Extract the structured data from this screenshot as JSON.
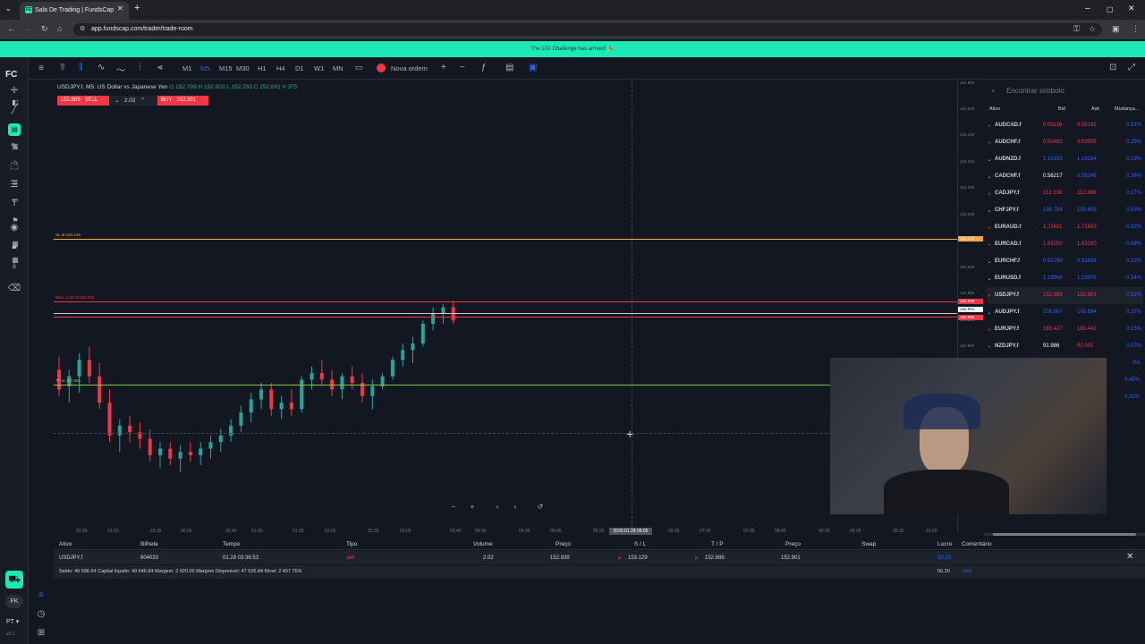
{
  "browser": {
    "tab_title": "Sala De Trading | FundsCap",
    "tab_favicon": "FC",
    "url": "app.fundscap.com/trader/trade-room",
    "new_tab": "+"
  },
  "banner": {
    "text": "The 10X Challenge has arrived! 🎉"
  },
  "app": {
    "logo": "FC",
    "user_initials": "FK",
    "language": "PT",
    "version": "v2.1"
  },
  "toolbar": {
    "timeframes": [
      "M1",
      "M5",
      "M15",
      "M30",
      "H1",
      "H4",
      "D1",
      "W1",
      "MN"
    ],
    "active_timeframe": "M5",
    "new_order": "Nova ordem"
  },
  "chart_header": {
    "symbol_title": "USDJPY.f, M5: US Dollar vs Japanese Yen",
    "ohlc": "O 152.799 H 152.903 L 152.783 C 152.891 V 375",
    "sell_price": "152.889",
    "sell_label": "SELL",
    "lot": "2.02",
    "buy_label": "BUY",
    "buy_price": "152.901"
  },
  "chart_lines": {
    "sl_label": "SL at 153.129",
    "sell_label": "SELL 2.02 at 152.939",
    "tp_label": "TP at 152.686"
  },
  "chart_data": {
    "type": "candlestick",
    "symbol": "USDJPY.f",
    "timeframe": "M5",
    "x_ticks": [
      "22:35",
      "23:00",
      "23:35",
      "00:05",
      "00:40",
      "01:00",
      "01:35",
      "02:00",
      "02:35",
      "03:00",
      "03:40",
      "04:00",
      "04:35",
      "05:00",
      "05:35",
      "2026.01.28 06:05",
      "06:35",
      "07:00",
      "07:35",
      "08:00",
      "08:35",
      "09:00",
      "09:35",
      "10:00"
    ],
    "y_ticks": [
      "153.600",
      "153.520",
      "153.440",
      "153.360",
      "153.280",
      "153.200",
      "153.120",
      "153.040",
      "152.960",
      "152.880",
      "152.800"
    ],
    "price_tags": {
      "sl": "153.129",
      "sell_entry": "152.939",
      "ask": "152.901",
      "bid": "152.889"
    },
    "ylim": [
      152.66,
      153.62
    ],
    "candles": [
      {
        "o": 152.72,
        "h": 152.76,
        "l": 152.64,
        "c": 152.66
      },
      {
        "o": 152.67,
        "h": 152.72,
        "l": 152.62,
        "c": 152.7
      },
      {
        "o": 152.7,
        "h": 152.77,
        "l": 152.65,
        "c": 152.75
      },
      {
        "o": 152.75,
        "h": 152.79,
        "l": 152.68,
        "c": 152.7
      },
      {
        "o": 152.7,
        "h": 152.74,
        "l": 152.6,
        "c": 152.62
      },
      {
        "o": 152.62,
        "h": 152.66,
        "l": 152.5,
        "c": 152.52
      },
      {
        "o": 152.52,
        "h": 152.57,
        "l": 152.47,
        "c": 152.55
      },
      {
        "o": 152.55,
        "h": 152.58,
        "l": 152.5,
        "c": 152.53
      },
      {
        "o": 152.53,
        "h": 152.56,
        "l": 152.48,
        "c": 152.51
      },
      {
        "o": 152.51,
        "h": 152.54,
        "l": 152.44,
        "c": 152.46
      },
      {
        "o": 152.46,
        "h": 152.5,
        "l": 152.42,
        "c": 152.48
      },
      {
        "o": 152.48,
        "h": 152.5,
        "l": 152.43,
        "c": 152.45
      },
      {
        "o": 152.45,
        "h": 152.49,
        "l": 152.41,
        "c": 152.47
      },
      {
        "o": 152.47,
        "h": 152.5,
        "l": 152.44,
        "c": 152.46
      },
      {
        "o": 152.46,
        "h": 152.5,
        "l": 152.43,
        "c": 152.48
      },
      {
        "o": 152.48,
        "h": 152.52,
        "l": 152.45,
        "c": 152.5
      },
      {
        "o": 152.5,
        "h": 152.54,
        "l": 152.47,
        "c": 152.52
      },
      {
        "o": 152.52,
        "h": 152.57,
        "l": 152.5,
        "c": 152.55
      },
      {
        "o": 152.55,
        "h": 152.61,
        "l": 152.53,
        "c": 152.59
      },
      {
        "o": 152.59,
        "h": 152.65,
        "l": 152.56,
        "c": 152.63
      },
      {
        "o": 152.63,
        "h": 152.68,
        "l": 152.6,
        "c": 152.66
      },
      {
        "o": 152.66,
        "h": 152.68,
        "l": 152.58,
        "c": 152.6
      },
      {
        "o": 152.6,
        "h": 152.64,
        "l": 152.57,
        "c": 152.62
      },
      {
        "o": 152.62,
        "h": 152.66,
        "l": 152.58,
        "c": 152.6
      },
      {
        "o": 152.6,
        "h": 152.7,
        "l": 152.59,
        "c": 152.69
      },
      {
        "o": 152.69,
        "h": 152.73,
        "l": 152.66,
        "c": 152.71
      },
      {
        "o": 152.71,
        "h": 152.75,
        "l": 152.67,
        "c": 152.69
      },
      {
        "o": 152.69,
        "h": 152.72,
        "l": 152.64,
        "c": 152.66
      },
      {
        "o": 152.66,
        "h": 152.71,
        "l": 152.63,
        "c": 152.7
      },
      {
        "o": 152.7,
        "h": 152.73,
        "l": 152.66,
        "c": 152.68
      },
      {
        "o": 152.68,
        "h": 152.71,
        "l": 152.62,
        "c": 152.64
      },
      {
        "o": 152.64,
        "h": 152.69,
        "l": 152.6,
        "c": 152.67
      },
      {
        "o": 152.67,
        "h": 152.71,
        "l": 152.66,
        "c": 152.7
      },
      {
        "o": 152.7,
        "h": 152.76,
        "l": 152.69,
        "c": 152.75
      },
      {
        "o": 152.75,
        "h": 152.8,
        "l": 152.73,
        "c": 152.78
      },
      {
        "o": 152.78,
        "h": 152.82,
        "l": 152.74,
        "c": 152.8
      },
      {
        "o": 152.8,
        "h": 152.87,
        "l": 152.79,
        "c": 152.86
      },
      {
        "o": 152.86,
        "h": 152.91,
        "l": 152.84,
        "c": 152.89
      },
      {
        "o": 152.89,
        "h": 152.92,
        "l": 152.86,
        "c": 152.91
      },
      {
        "o": 152.91,
        "h": 152.93,
        "l": 152.86,
        "c": 152.87
      }
    ]
  },
  "watchlist": {
    "search_placeholder": "Encontrar símbolo",
    "headers": [
      "Ativo",
      "Bid",
      "Ask",
      "Mudança..."
    ],
    "rows": [
      {
        "symbol": "AUDCAD.f",
        "bid": "0.95116",
        "ask": "0.95142",
        "change": "0.01%",
        "dir": "down"
      },
      {
        "symbol": "AUDCHF.f",
        "bid": "0.53482",
        "ask": "0.53508",
        "change": "0.29%",
        "dir": "down"
      },
      {
        "symbol": "AUDNZD.f",
        "bid": "1.16163",
        "ask": "1.16194",
        "change": "0.19%",
        "dir": "up"
      },
      {
        "symbol": "CADCHF.f",
        "bid": "0.56217",
        "ask": "0.56249",
        "change": "0.36%",
        "dir": "up"
      },
      {
        "symbol": "CADJPY.f",
        "bid": "112.338",
        "ask": "112.366",
        "change": "0.27%",
        "dir": "down"
      },
      {
        "symbol": "CHFJPY.f",
        "bid": "199.784",
        "ask": "199.809",
        "change": "0.03%",
        "dir": "up"
      },
      {
        "symbol": "EURAUD.f",
        "bid": "1.71611",
        "ask": "1.71635",
        "change": "-0.02%",
        "dir": "down"
      },
      {
        "symbol": "EURCAD.f",
        "bid": "1.63250",
        "ask": "1.63280",
        "change": "-0.09%",
        "dir": "down"
      },
      {
        "symbol": "EURCHF.f",
        "bid": "0.91799",
        "ask": "0.91818",
        "change": "0.22%",
        "dir": "up"
      },
      {
        "symbol": "EURUSD.f",
        "bid": "1.19968",
        "ask": "1.19979",
        "change": "-0.34%",
        "dir": "up"
      },
      {
        "symbol": "USDJPY.f",
        "bid": "152.889",
        "ask": "152.901",
        "change": "0.52%",
        "dir": "down"
      },
      {
        "symbol": "AUDJPY.f",
        "bid": "106.867",
        "ask": "106.894",
        "change": "0.22%",
        "dir": "up"
      },
      {
        "symbol": "EURJPY.f",
        "bid": "183.427",
        "ask": "183.442",
        "change": "0.15%",
        "dir": "down"
      },
      {
        "symbol": "NZDJPY.f",
        "bid": "91.986",
        "ask": "92.007",
        "change": "0.07%",
        "dir": "down"
      }
    ],
    "extra_changes": [
      "0%",
      "0.45%",
      "0.31%"
    ]
  },
  "positions": {
    "headers": [
      "Ativo",
      "Bilhete",
      "Tempo",
      "Tipo",
      "Volume",
      "Preço",
      "S / L",
      "T / P",
      "Preço",
      "Swap",
      "Lucro",
      "Comentário"
    ],
    "row": {
      "symbol": "USDJPY.f",
      "ticket": "804033",
      "time": "01.28 03:36:53",
      "type": "sell",
      "volume": "2.02",
      "price": "152.939",
      "sl": "153.129",
      "tp": "152.686",
      "current": "152.901",
      "profit": "50.20"
    },
    "summary": "Saldo: 49 596.64   Capital líquido: 49 646.84   Margem: 2 020.00   Margem Disponível: 47 626.84   Nível: 2 457.76%",
    "summary_profit": "50.20",
    "currency": "USD"
  },
  "colors": {
    "accent": "#1de9b6",
    "up": "#26a69a",
    "down": "#f23645",
    "blue": "#2962ff"
  }
}
